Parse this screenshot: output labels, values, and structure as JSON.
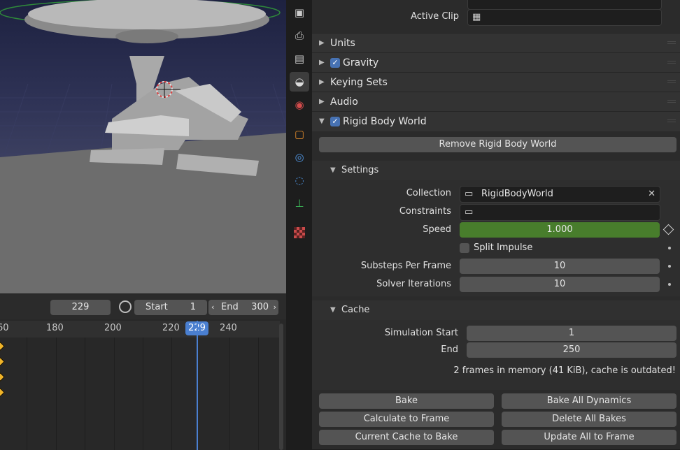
{
  "timeline": {
    "current_frame": "229",
    "start_label": "Start",
    "start_value": "1",
    "end_label": "End",
    "end_value": "300",
    "ruler_ticks": [
      "60",
      "180",
      "200",
      "220",
      "240"
    ],
    "playhead_label": "229"
  },
  "properties": {
    "active_clip_label": "Active Clip",
    "panels": {
      "units": "Units",
      "gravity": "Gravity",
      "keying_sets": "Keying Sets",
      "audio": "Audio",
      "rigid_body_world": "Rigid Body World"
    },
    "remove_button": "Remove Rigid Body World",
    "settings": {
      "header": "Settings",
      "collection_label": "Collection",
      "collection_value": "RigidBodyWorld",
      "constraints_label": "Constraints",
      "constraints_value": "",
      "speed_label": "Speed",
      "speed_value": "1.000",
      "split_impulse_label": "Split Impulse",
      "substeps_label": "Substeps Per Frame",
      "substeps_value": "10",
      "solver_label": "Solver Iterations",
      "solver_value": "10"
    },
    "cache": {
      "header": "Cache",
      "sim_start_label": "Simulation Start",
      "sim_start_value": "1",
      "end_label": "End",
      "end_value": "250",
      "status": "2 frames in memory (41 KiB), cache is outdated!"
    },
    "bake_buttons": {
      "bake": "Bake",
      "bake_all": "Bake All Dynamics",
      "calc_to_frame": "Calculate to Frame",
      "delete_all": "Delete All Bakes",
      "current_cache": "Current Cache to Bake",
      "update_all": "Update All to Frame"
    }
  },
  "colors": {
    "accent_blue": "#4772b3",
    "speed_green": "#487d2c",
    "key_yellow": "#f0b429",
    "playhead_blue": "#4a7fd0"
  }
}
